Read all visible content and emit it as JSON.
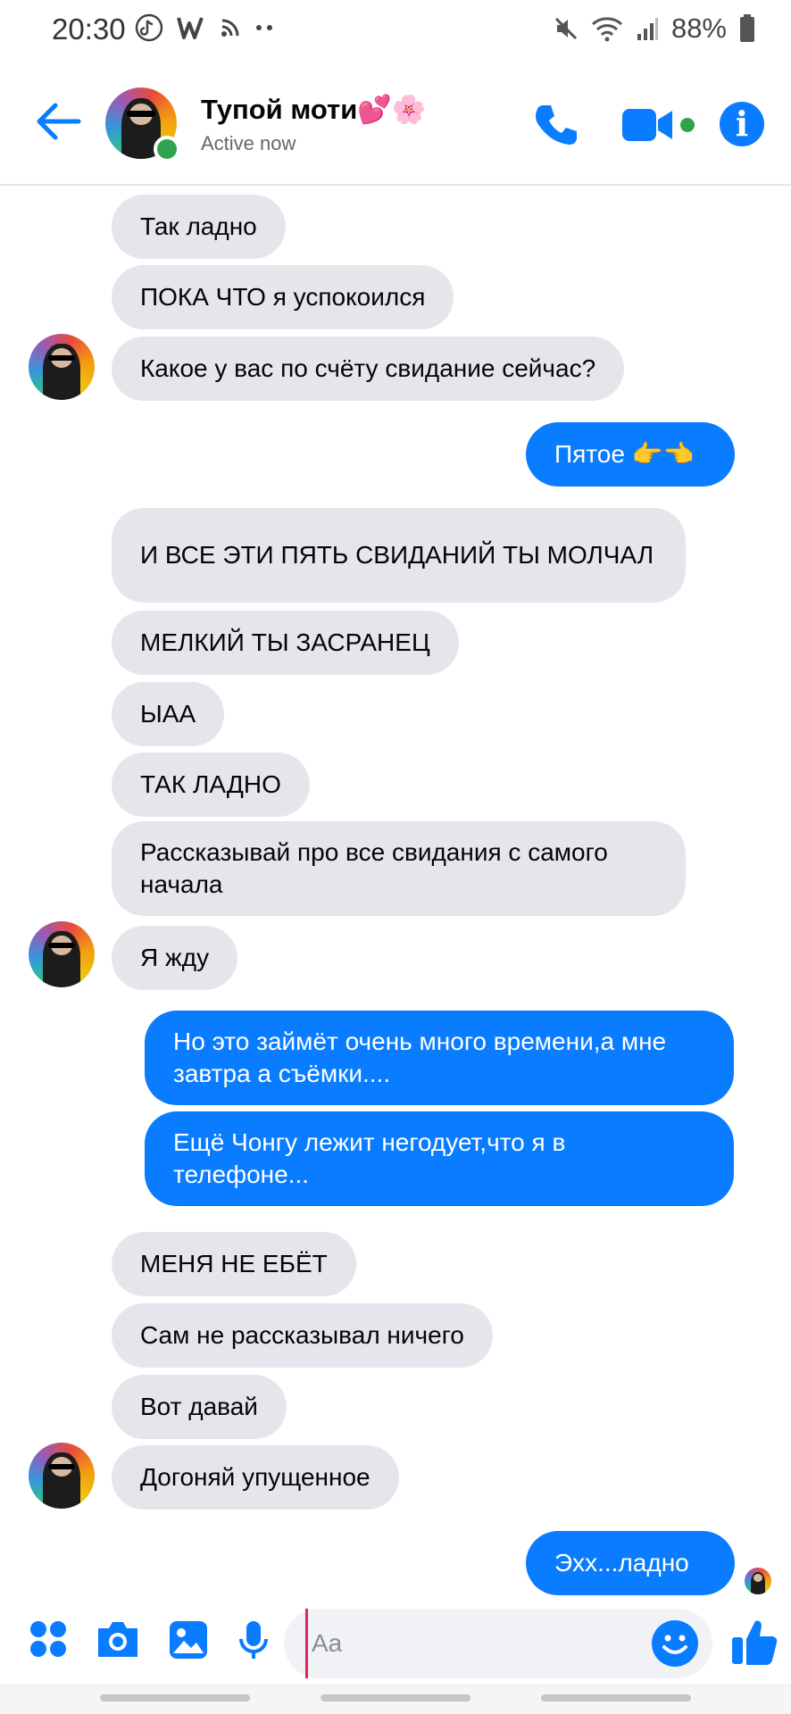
{
  "status_bar": {
    "time": "20:30",
    "battery": "88%",
    "icons_left": [
      "tiktok-icon",
      "w-icon",
      "rss-icon",
      "more-dots-icon"
    ],
    "icons_right": [
      "mute-icon",
      "wifi-icon",
      "signal-icon",
      "battery-icon"
    ]
  },
  "header": {
    "name": "Тупой моти💕🌸",
    "status": "Active now",
    "accent": "#0a7cff",
    "online_color": "#31a24c"
  },
  "messages": [
    {
      "dir": "in",
      "text": "Так ладно"
    },
    {
      "dir": "in",
      "text": "ПОКА ЧТО я успокоился"
    },
    {
      "dir": "in",
      "text": "Какое у вас по счёту свидание сейчас?"
    },
    {
      "dir": "out",
      "text": "Пятое 👉👈"
    },
    {
      "dir": "in",
      "text": "И ВСЕ ЭТИ ПЯТЬ СВИДАНИЙ ТЫ МОЛЧАЛ"
    },
    {
      "dir": "in",
      "text": "МЕЛКИЙ ТЫ ЗАСРАНЕЦ"
    },
    {
      "dir": "in",
      "text": "ЫАА"
    },
    {
      "dir": "in",
      "text": "ТАК ЛАДНО"
    },
    {
      "dir": "in",
      "text": "Рассказывай про все свидания с самого начала"
    },
    {
      "dir": "in",
      "text": "Я жду"
    },
    {
      "dir": "out",
      "text": "Но это займёт очень много времени,а мне завтра а съёмки...."
    },
    {
      "dir": "out",
      "text": "Ещё Чонгу лежит негодует,что я в телефоне..."
    },
    {
      "dir": "in",
      "text": "МЕНЯ НЕ ЕБЁТ"
    },
    {
      "dir": "in",
      "text": "Сам не рассказывал ничего"
    },
    {
      "dir": "in",
      "text": "Вот давай"
    },
    {
      "dir": "in",
      "text": "Догоняй упущенное"
    },
    {
      "dir": "out",
      "text": "Эхх...ладно"
    }
  ],
  "composer": {
    "placeholder": "Aa",
    "icons": [
      "apps-icon",
      "camera-icon",
      "gallery-icon",
      "mic-icon",
      "emoji-icon",
      "like-icon"
    ]
  }
}
